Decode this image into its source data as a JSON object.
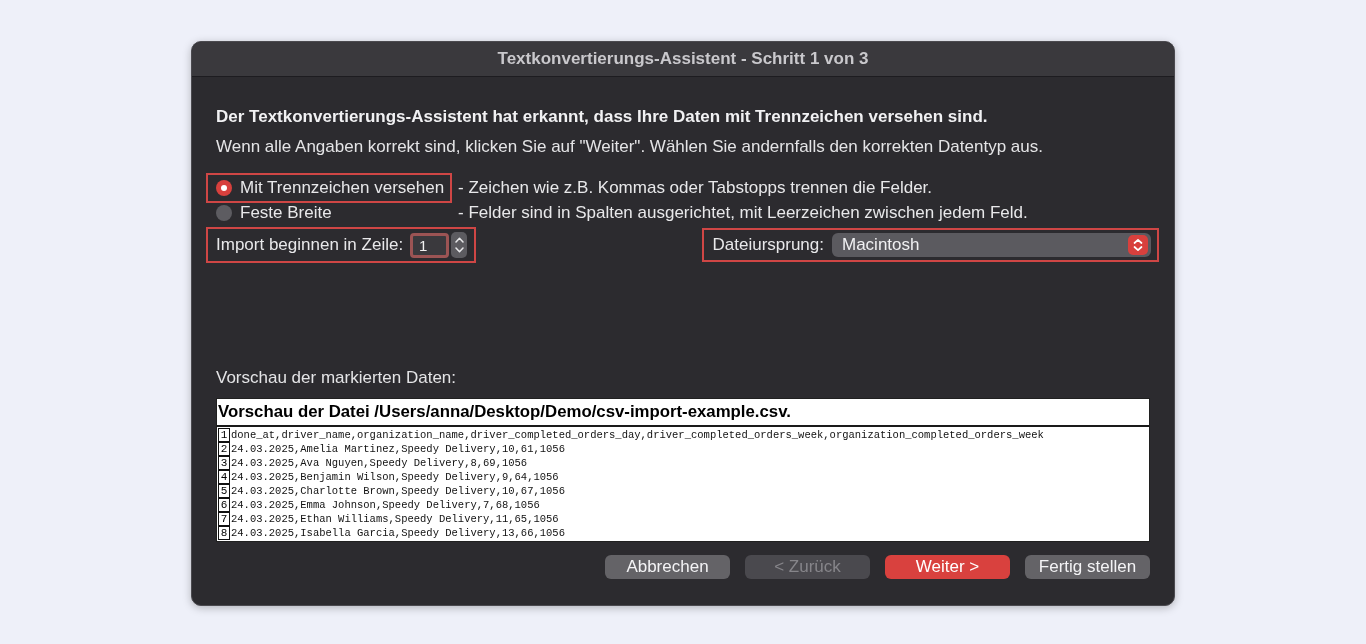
{
  "window": {
    "title": "Textkonvertierungs-Assistent - Schritt 1 von 3"
  },
  "intro": {
    "heading": "Der Textkonvertierungs-Assistent hat erkannt, dass Ihre Daten mit Trennzeichen versehen sind.",
    "text": "Wenn alle Angaben korrekt sind, klicken Sie auf \"Weiter\". Wählen Sie andernfalls den korrekten Datentyp aus."
  },
  "data_types": [
    {
      "label": "Mit Trennzeichen versehen",
      "description": "- Zeichen wie z.B. Kommas oder Tabstopps trennen die Felder.",
      "selected": true,
      "highlighted": true
    },
    {
      "label": "Feste Breite",
      "description": "- Felder sind in Spalten ausgerichtet, mit Leerzeichen zwischen jedem Feld.",
      "selected": false,
      "highlighted": false
    }
  ],
  "start_row": {
    "label": "Import beginnen in Zeile:",
    "value": "1",
    "focused": true,
    "highlighted": true
  },
  "file_origin": {
    "label": "Dateiursprung:",
    "value": "Macintosh",
    "highlighted": true
  },
  "preview": {
    "label": "Vorschau der markierten Daten:",
    "title": "Vorschau der Datei /Users/anna/Desktop/Demo/csv-import-example.csv.",
    "lines": [
      {
        "number": "1",
        "text": "done_at,driver_name,organization_name,driver_completed_orders_day,driver_completed_orders_week,organization_completed_orders_week"
      },
      {
        "number": "2",
        "text": "24.03.2025,Amelia Martinez,Speedy Delivery,10,61,1056"
      },
      {
        "number": "3",
        "text": "24.03.2025,Ava Nguyen,Speedy Delivery,8,69,1056"
      },
      {
        "number": "4",
        "text": "24.03.2025,Benjamin Wilson,Speedy Delivery,9,64,1056"
      },
      {
        "number": "5",
        "text": "24.03.2025,Charlotte Brown,Speedy Delivery,10,67,1056"
      },
      {
        "number": "6",
        "text": "24.03.2025,Emma Johnson,Speedy Delivery,7,68,1056"
      },
      {
        "number": "7",
        "text": "24.03.2025,Ethan Williams,Speedy Delivery,11,65,1056"
      },
      {
        "number": "8",
        "text": "24.03.2025,Isabella Garcia,Speedy Delivery,13,66,1056"
      }
    ]
  },
  "buttons": [
    {
      "label": "Abbrechen",
      "kind": "default",
      "disabled": false
    },
    {
      "label": "< Zurück",
      "kind": "default",
      "disabled": true
    },
    {
      "label": "Weiter >",
      "kind": "primary",
      "disabled": false
    },
    {
      "label": "Fertig stellen",
      "kind": "default",
      "disabled": false
    }
  ]
}
